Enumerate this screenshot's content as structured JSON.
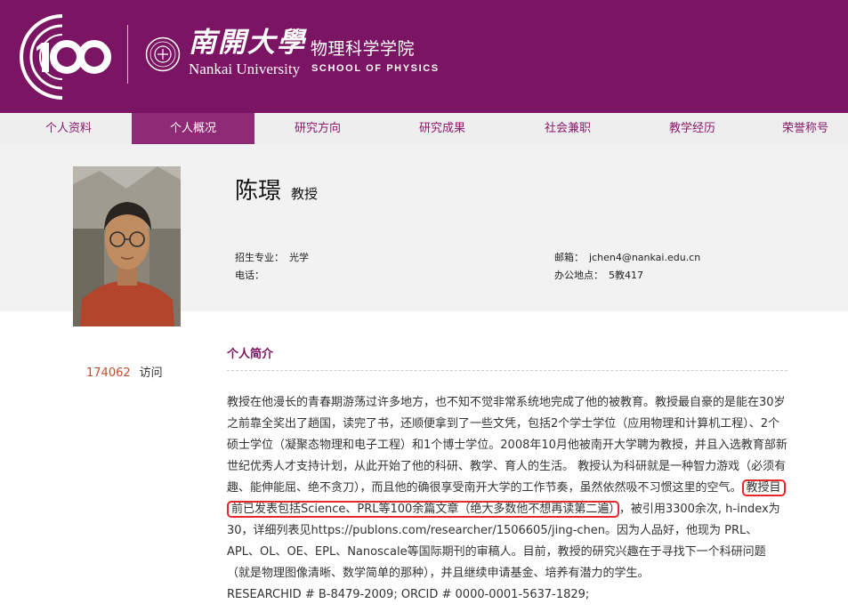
{
  "header": {
    "anniversary_logo": "100",
    "university_cn": "南開大學",
    "university_en": "Nankai University",
    "school_cn": "物理科学学院",
    "school_en": "SCHOOL OF PHYSICS",
    "brand_color": "#7c1464"
  },
  "nav": {
    "items": [
      "个人资料",
      "个人概况",
      "研究方向",
      "研究成果",
      "社会兼职",
      "教学经历",
      "荣誉称号"
    ],
    "active_index": 1
  },
  "profile": {
    "name": "陈璟",
    "rank": "教授",
    "major_label": "招生专业：",
    "major_value": "光学",
    "phone_label": "电话：",
    "phone_value": "",
    "email_label": "邮箱：",
    "email_value": "jchen4@nankai.edu.cn",
    "office_label": "办公地点：",
    "office_value": "5教417"
  },
  "visits": {
    "count": "174062",
    "label": "访问"
  },
  "intro": {
    "title": "个人简介",
    "text_before": "教授在他漫长的青春期游荡过许多地方，也不知不觉非常系统地完成了他的被教育。教授最自豪的是能在30岁之前靠全奖出了趟国，读完了书，还顺便拿到了一些文凭，包括2个学士学位（应用物理和计算机工程）、2个硕士学位（凝聚态物理和电子工程）和1个博士学位。2008年10月他被南开大学聘为教授，并且入选教育部新世纪优秀人才支持计划，从此开始了他的科研、教学、育人的生活。 教授认为科研就是一种智力游戏（必须有趣、能伸能屈、绝不贪刀），而且他的确很享受南开大学的工作节奏，虽然依然吸不习惯这里的空气。",
    "text_highlight": "教授目前已发表包括Science、PRL等100余篇文章（绝大多数他不想再读第二遍）",
    "text_after": "，被引用3300余次, h-index为30，详细列表见https://publons.com/researcher/1506605/jing-chen。因为人品好，他现为 PRL、APL、OL、OE、EPL、Nanoscale等国际期刊的审稿人。目前，教授的研究兴趣在于寻找下一个科研问题（就是物理图像清晰、数学简单的那种），并且继续申请基金、培养有潜力的学生。",
    "ids": "RESEARCHID # B-8479-2009; ORCID # 0000-0001-5637-1829;",
    "highlight_color": "#e4282c"
  }
}
